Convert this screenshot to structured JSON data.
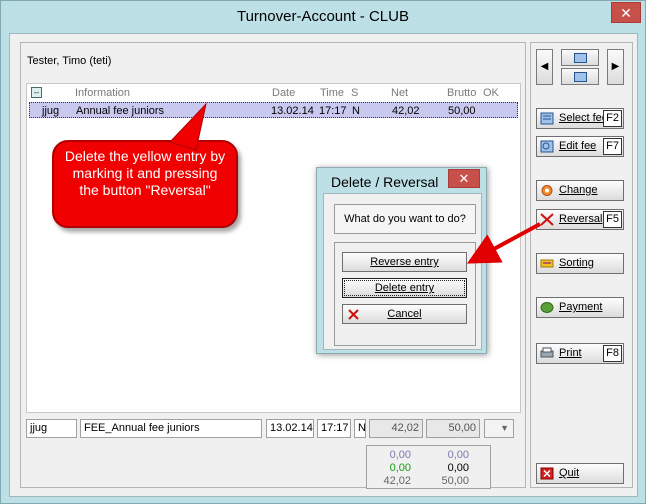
{
  "window": {
    "title": "Turnover-Account - CLUB",
    "close": "✕"
  },
  "person": "Tester, Timo (teti)",
  "list": {
    "headers": [
      "Information",
      "Date",
      "Time",
      "S",
      "Net",
      "Brutto",
      "OK"
    ],
    "rows": [
      {
        "code": "jjug",
        "info": "Annual fee juniors",
        "date": "13.02.14",
        "time": "17:17",
        "s": "N",
        "net": "42,02",
        "brutto": "50,00"
      }
    ]
  },
  "entry": {
    "code": "jjug",
    "info": "FEE_Annual fee juniors",
    "date": "13.02.14",
    "time": "17:17",
    "s": "N",
    "net": "42,02",
    "brutto": "50,00"
  },
  "totals": {
    "r1": [
      "0,00",
      "0,00"
    ],
    "r2": [
      "0,00",
      "0,00"
    ],
    "r3": [
      "42,02",
      "50,00"
    ]
  },
  "colors": {
    "accent_red": "#f00000",
    "row_highlight": "#c9c9ef",
    "window_bg": "#bde0e6"
  },
  "sidebar": {
    "select_fee": {
      "label": "Select fee",
      "key": "F2"
    },
    "edit_fee": {
      "label": "Edit fee",
      "key": "F7"
    },
    "change": {
      "label": "Change"
    },
    "reversal": {
      "label": "Reversal",
      "key": "F5"
    },
    "sorting": {
      "label": "Sorting"
    },
    "payment": {
      "label": "Payment"
    },
    "print": {
      "label": "Print",
      "key": "F8"
    },
    "quit": {
      "label": "Quit"
    }
  },
  "callout": "Delete the yellow entry by marking it and pressing the button \"Reversal\"",
  "dialog": {
    "title": "Delete / Reversal",
    "close": "✕",
    "question": "What do you want to do?",
    "reverse": "Reverse entry",
    "delete": "Delete entry",
    "cancel": "Cancel"
  }
}
